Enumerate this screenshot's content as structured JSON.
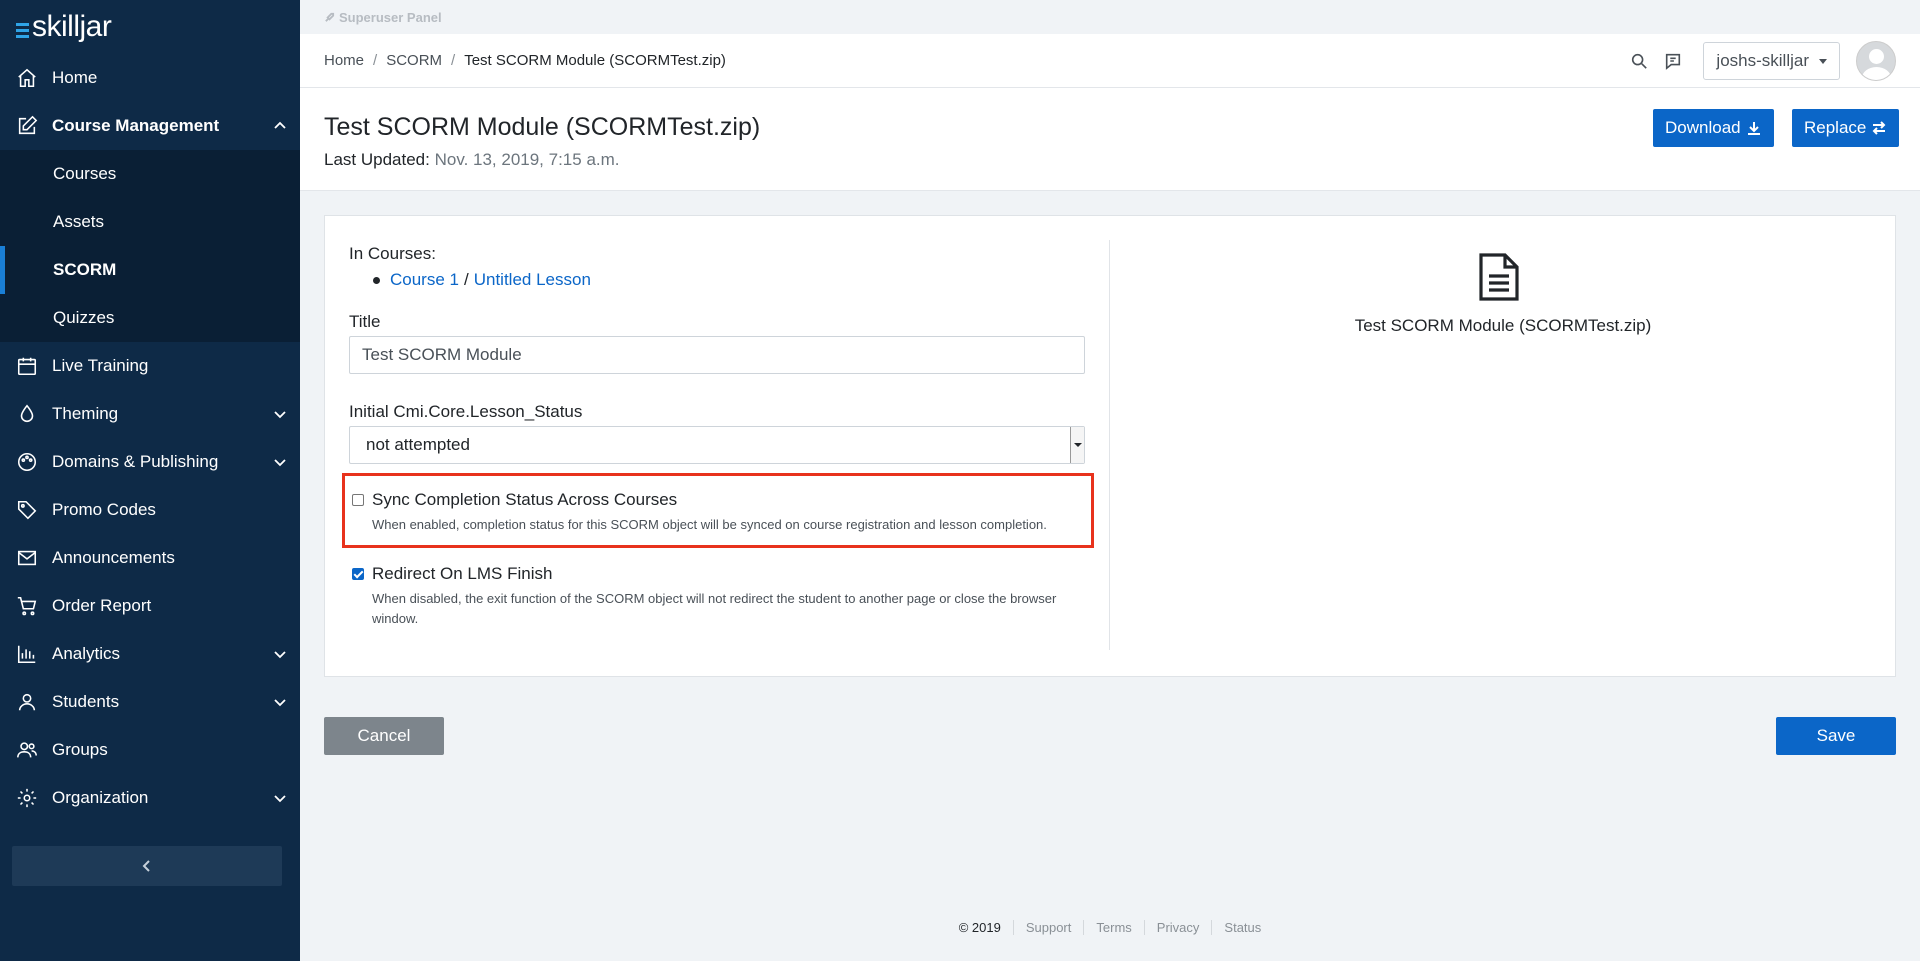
{
  "app": {
    "logo_text": "skilljar"
  },
  "sidebar": {
    "items": [
      {
        "label": "Home",
        "icon": "home-icon"
      },
      {
        "label": "Course Management",
        "icon": "edit-icon",
        "expanded": true,
        "children": [
          {
            "label": "Courses"
          },
          {
            "label": "Assets"
          },
          {
            "label": "SCORM",
            "active": true
          },
          {
            "label": "Quizzes"
          }
        ]
      },
      {
        "label": "Live Training",
        "icon": "calendar-icon"
      },
      {
        "label": "Theming",
        "icon": "droplet-icon",
        "has_children": true
      },
      {
        "label": "Domains & Publishing",
        "icon": "paint-icon",
        "has_children": true
      },
      {
        "label": "Promo Codes",
        "icon": "tag-icon"
      },
      {
        "label": "Announcements",
        "icon": "mail-icon"
      },
      {
        "label": "Order Report",
        "icon": "cart-icon"
      },
      {
        "label": "Analytics",
        "icon": "bar-chart-icon",
        "has_children": true
      },
      {
        "label": "Students",
        "icon": "user-icon",
        "has_children": true
      },
      {
        "label": "Groups",
        "icon": "users-icon"
      },
      {
        "label": "Organization",
        "icon": "gear-icon",
        "has_children": true
      }
    ]
  },
  "superuser": {
    "label": "Superuser Panel"
  },
  "breadcrumb": {
    "home": "Home",
    "section": "SCORM",
    "current": "Test SCORM Module (SCORMTest.zip)"
  },
  "user": {
    "name": "joshs-skilljar"
  },
  "header": {
    "title": "Test SCORM Module (SCORMTest.zip)",
    "last_updated_label": "Last Updated:",
    "last_updated_value": "Nov. 13, 2019, 7:15 a.m.",
    "download_label": "Download",
    "replace_label": "Replace"
  },
  "form": {
    "in_courses_label": "In Courses:",
    "course_link": "Course 1",
    "course_sep": "/",
    "lesson_link": "Untitled Lesson",
    "title_label": "Title",
    "title_value": "Test SCORM Module",
    "status_label": "Initial Cmi.Core.Lesson_Status",
    "status_value": "not attempted",
    "sync": {
      "label": "Sync Completion Status Across Courses",
      "checked": false,
      "help": "When enabled, completion status for this SCORM object will be synced on course registration and lesson completion."
    },
    "redirect": {
      "label": "Redirect On LMS Finish",
      "checked": true,
      "help": "When disabled, the exit function of the SCORM object will not redirect the student to another page or close the browser window."
    }
  },
  "preview": {
    "icon": "file-text-icon",
    "name": "Test SCORM Module (SCORMTest.zip)"
  },
  "actions": {
    "cancel_label": "Cancel",
    "save_label": "Save"
  },
  "footer": {
    "copyright": "© 2019",
    "support": "Support",
    "terms": "Terms",
    "privacy": "Privacy",
    "status": "Status"
  },
  "colors": {
    "sidebar_bg": "#0e2a47",
    "primary": "#0b66c8",
    "highlight": "#e8321c"
  }
}
